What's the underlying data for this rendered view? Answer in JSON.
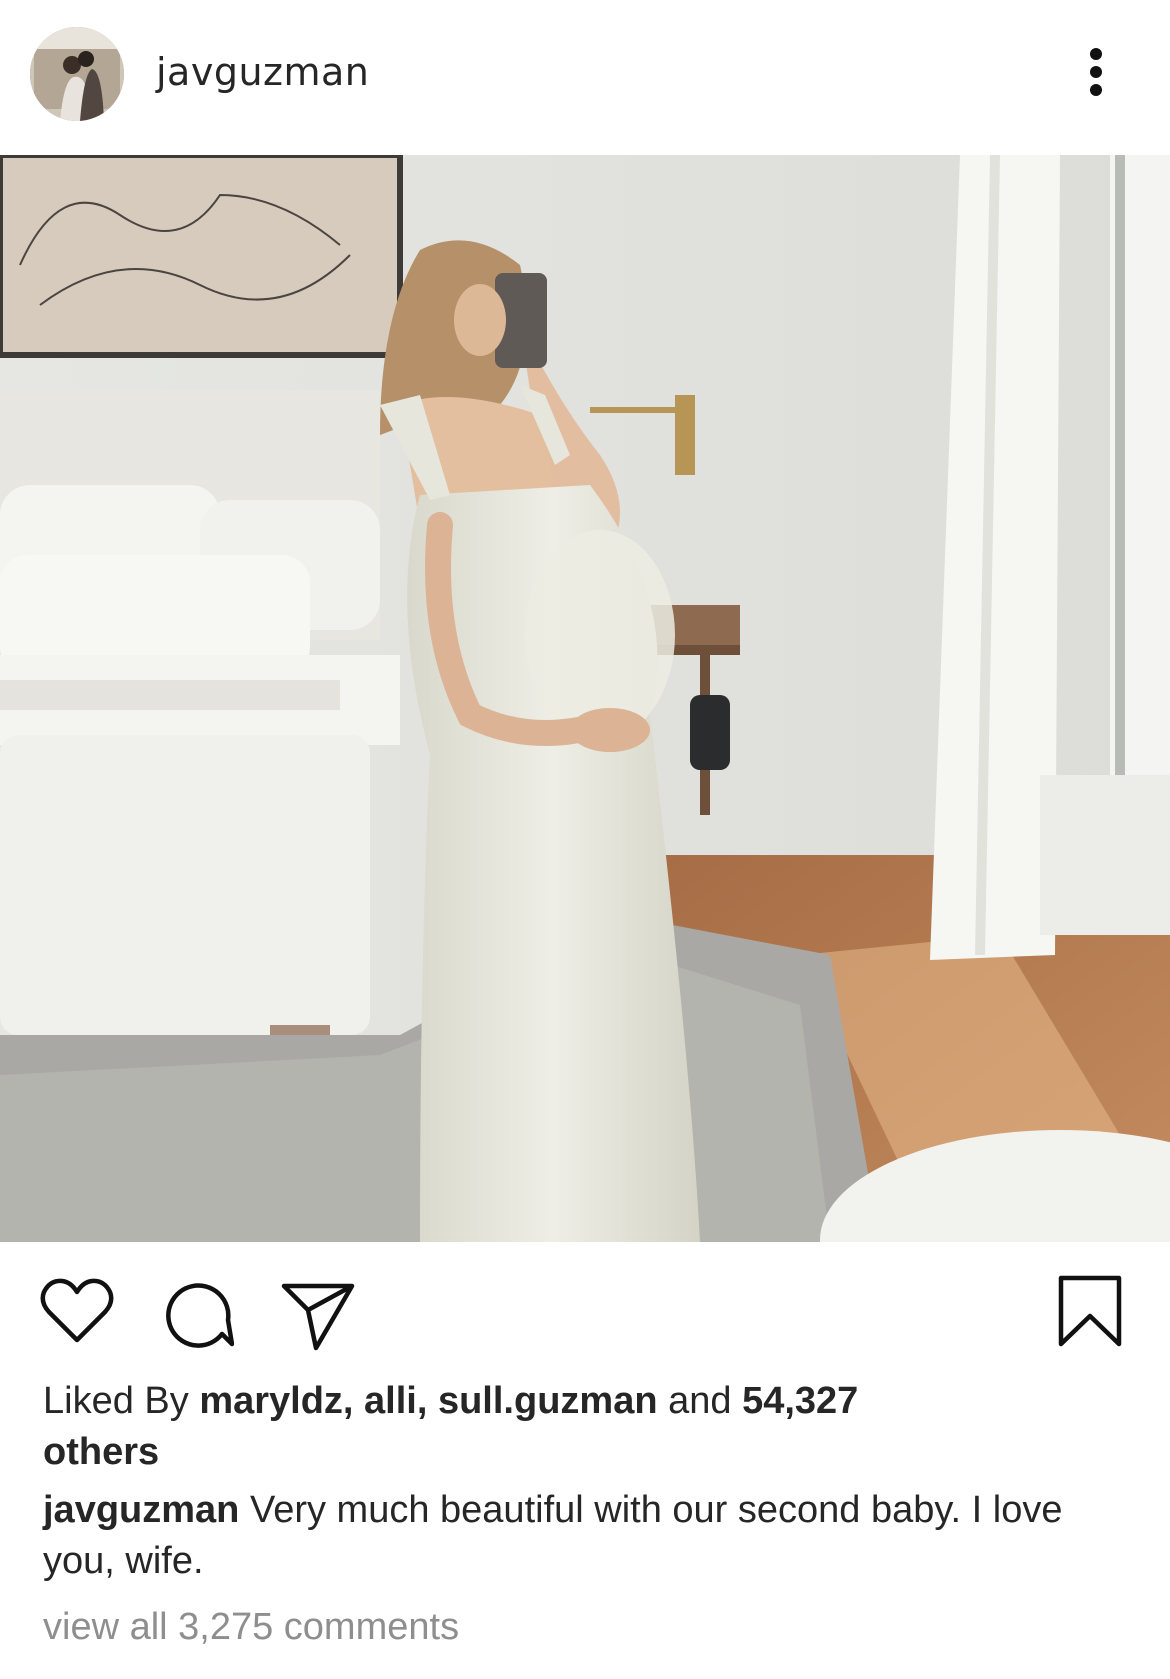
{
  "header": {
    "username": "javguzman",
    "avatar_icon": "profile-avatar",
    "more_icon": "more-vertical-icon"
  },
  "post": {
    "image_alt": "Pregnant woman in white dress taking a mirror selfie in a bright bedroom"
  },
  "actions": {
    "like_icon": "heart-icon",
    "comment_icon": "comment-icon",
    "share_icon": "send-icon",
    "save_icon": "bookmark-icon"
  },
  "likes": {
    "prefix": "Liked By ",
    "users": "maryldz, alli, sull.guzman",
    "conjunction": " and ",
    "count": "54,327",
    "suffix": "others"
  },
  "caption": {
    "username": "javguzman",
    "text": "Very much beautiful with our second baby. I love you, wife."
  },
  "comments_link": "view all 3,275 comments",
  "colors": {
    "text": "#262626",
    "secondary": "#8e8e8e",
    "background": "#ffffff"
  }
}
